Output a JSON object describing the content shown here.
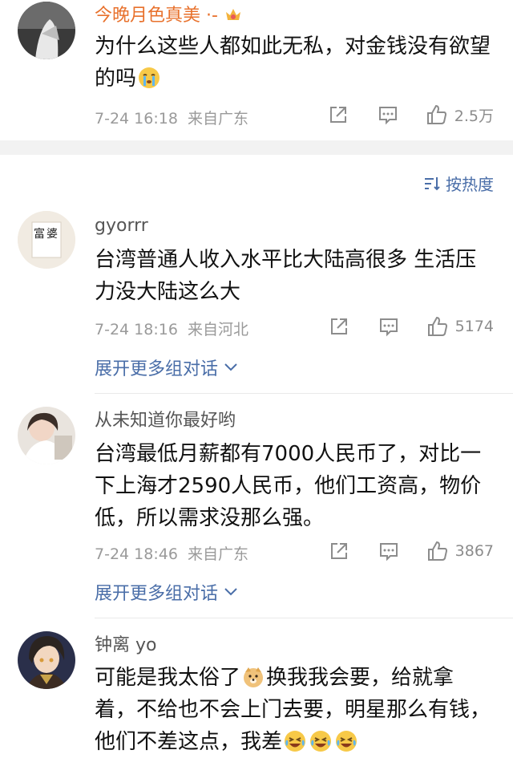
{
  "comments": [
    {
      "username": "今晚月色真美 ·-",
      "text": "为什么这些人都如此无私，对金钱没有欲望的吗",
      "time": "7-24 16:18",
      "location": "来自广东",
      "likes": "2.5万"
    },
    {
      "username": "gyorrr",
      "avatar_text": "富婆",
      "text": "台湾普通人收入水平比大陆高很多 生活压力没大陆这么大",
      "time": "7-24 18:16",
      "location": "来自河北",
      "likes": "5174",
      "expand_label": "展开更多组对话"
    },
    {
      "username": "从未知道你最好哟",
      "text": "台湾最低月薪都有7000人民币了，对比一下上海才2590人民币，他们工资高，物价低，所以需求没那么强。",
      "time": "7-24 18:46",
      "location": "来自广东",
      "likes": "3867",
      "expand_label": "展开更多组对话"
    },
    {
      "username": "钟离 yo",
      "text_a": "可能是我太俗了",
      "text_b": "换我我会要，给就拿着，不给也不会上门去要，明星那么有钱，他们不差这点，我差"
    }
  ],
  "sort_label": "按热度",
  "icons": {
    "share": "share-icon",
    "comment": "comment-icon",
    "like": "thumbs-up-icon",
    "sort": "sort-icon",
    "chevron": "chevron-down-icon"
  }
}
